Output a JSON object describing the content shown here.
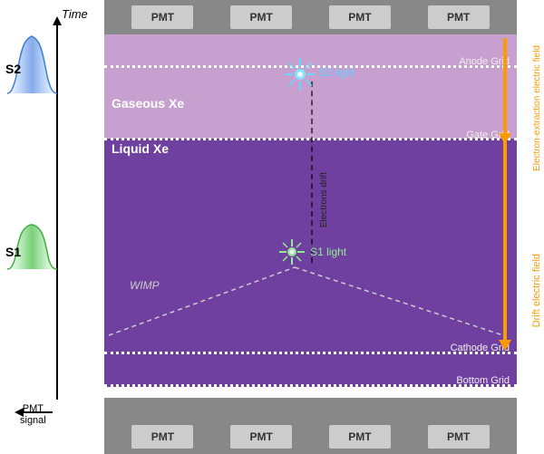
{
  "left": {
    "time_label": "Time",
    "s2_label": "S2",
    "s1_label": "S1",
    "pmt_signal_label": "PMT\nsignal"
  },
  "diagram": {
    "top_pmts": [
      "PMT",
      "PMT",
      "PMT",
      "PMT"
    ],
    "bottom_pmts": [
      "PMT",
      "PMT",
      "PMT",
      "PMT"
    ],
    "gaseous_label": "Gaseous Xe",
    "liquid_label": "Liquid Xe",
    "anode_label": "Anode Grid",
    "gate_label": "Gate Grid",
    "cathode_label": "Cathode Grid",
    "bottom_grid_label": "Bottom Grid",
    "s2_light_label": "S2 light",
    "s1_light_label": "S1 light",
    "electrons_drift_label": "Electrons drift",
    "wimp_label": "WIMP",
    "drift_field_label": "Drift electric field",
    "extraction_field_label": "Electron-extraction electric field"
  },
  "colors": {
    "gaseous_bg": "#c8a0d0",
    "liquid_bg": "#7040a0",
    "pmt_bg": "#888888",
    "pmt_box": "#cccccc",
    "orange": "#f90000",
    "s2_color": "#60d0ff",
    "s1_color": "#90ee90"
  }
}
